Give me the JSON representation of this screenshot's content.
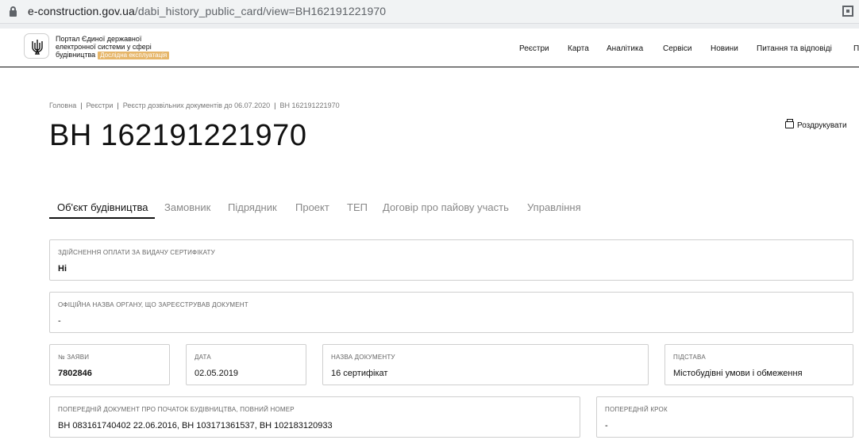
{
  "browser": {
    "url_host": "e-construction.gov.ua",
    "url_path": "/dabi_history_public_card/view=ВН162191221970"
  },
  "header": {
    "portal_line1": "Портал Єдиної державної",
    "portal_line2": "електронної системи у сфері",
    "portal_line3": "будівництва",
    "badge": "Дослідна експлуатація",
    "nav": [
      "Реєстри",
      "Карта",
      "Аналітика",
      "Сервіси",
      "Новини",
      "Питання та відповіді",
      "П"
    ]
  },
  "breadcrumb": [
    "Головна",
    "Реєстри",
    "Реєстр дозвільних документів до 06.07.2020",
    "ВН 162191221970"
  ],
  "title": "ВН 162191221970",
  "print_label": "Роздрукувати",
  "tabs": [
    "Об'єкт будівництва",
    "Замовник",
    "Підрядник",
    "Проект",
    "ТЕП",
    "Договір про пайову участь",
    "Управління"
  ],
  "fields": {
    "payment": {
      "label": "Здійснення оплати за видачу сертифікату",
      "value": "Ні"
    },
    "authority": {
      "label": "Офіційна назва органу, що зареєстрував документ",
      "value": "-"
    },
    "application_no": {
      "label": "№ заяви",
      "value": "7802846"
    },
    "date": {
      "label": "Дата",
      "value": "02.05.2019"
    },
    "doc_name": {
      "label": "Назва документу",
      "value": "16 сертифікат"
    },
    "basis": {
      "label": "Підстава",
      "value": "Містобудівні умови і обмеження"
    },
    "prev_doc": {
      "label": "Попередній документ про початок будівництва, повний номер",
      "value": "ВН 083161740402 22.06.2016, ВН 103171361537, ВН 102183120933"
    },
    "prev_step": {
      "label": "Попередній крок",
      "value": "-"
    }
  }
}
